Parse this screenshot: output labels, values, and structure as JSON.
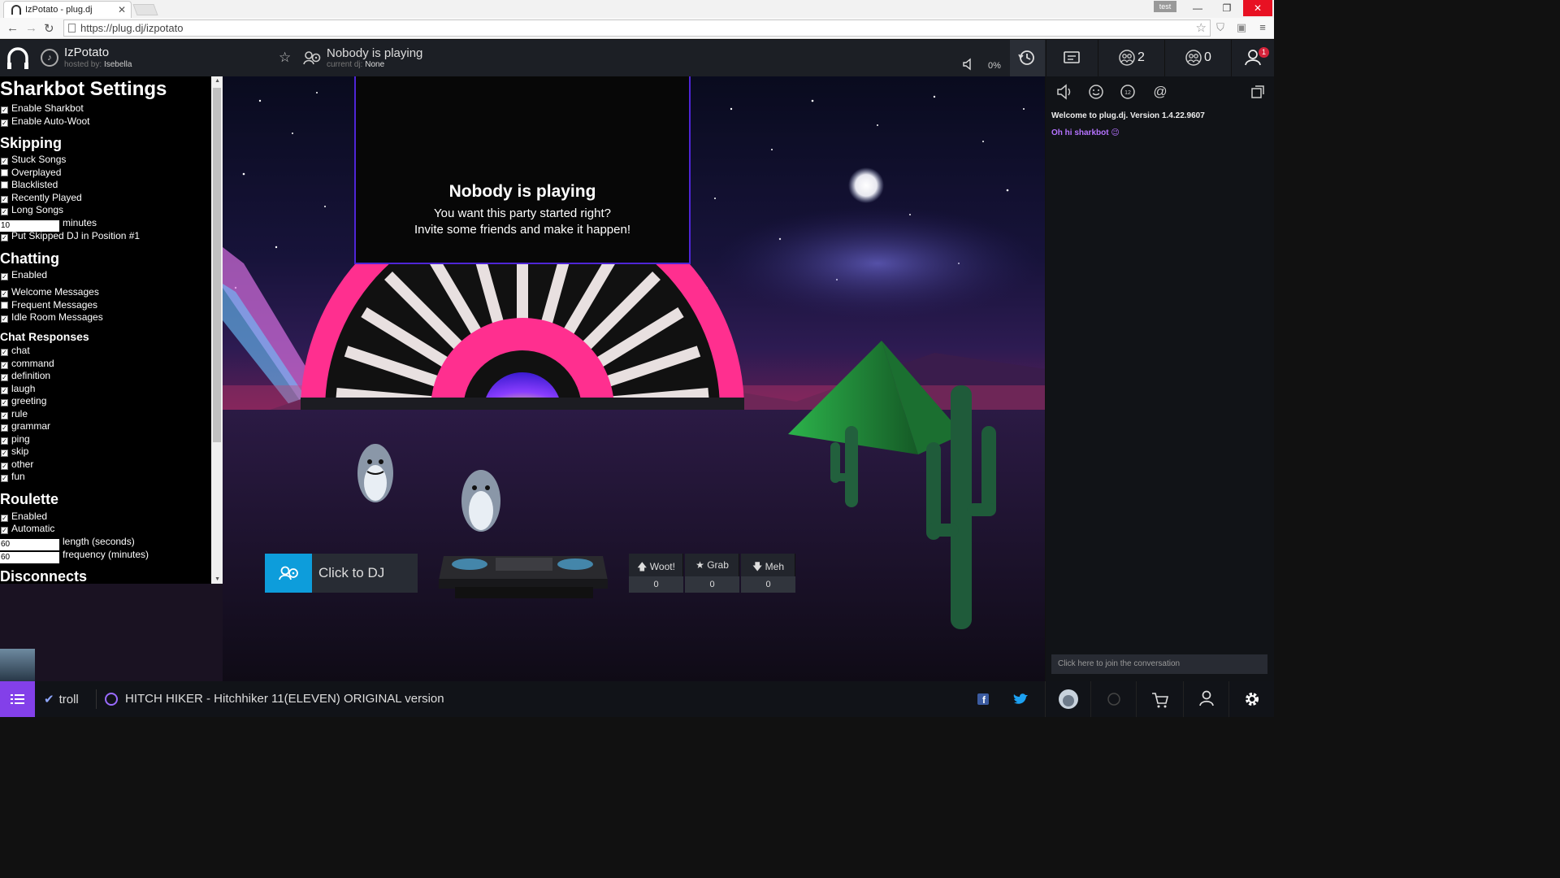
{
  "browser": {
    "tab_title": "IzPotato - plug.dj",
    "url": "https://plug.dj/izpotato",
    "user_badge": "test"
  },
  "header": {
    "room_name": "IzPotato",
    "hosted_by_label": "hosted by:",
    "hosted_by": "Isebella",
    "now_playing": "Nobody is playing",
    "current_dj_label": "current dj:",
    "current_dj": "None",
    "volume": "0%",
    "audience_count": "2",
    "staff_count": "0",
    "notification_count": "1"
  },
  "settings": {
    "title": "Sharkbot Settings",
    "general": [
      {
        "label": "Enable Sharkbot",
        "checked": true
      },
      {
        "label": "Enable Auto-Woot",
        "checked": true
      }
    ],
    "skipping_title": "Skipping",
    "skipping": [
      {
        "label": "Stuck Songs",
        "checked": true
      },
      {
        "label": "Overplayed",
        "checked": false
      },
      {
        "label": "Blacklisted",
        "checked": false
      },
      {
        "label": "Recently Played",
        "checked": true
      },
      {
        "label": "Long Songs",
        "checked": true
      }
    ],
    "long_songs_minutes_value": "10",
    "long_songs_minutes_label": "minutes",
    "put_skipped": {
      "label": "Put Skipped DJ in Position #1",
      "checked": true
    },
    "chatting_title": "Chatting",
    "chatting_enabled": {
      "label": "Enabled",
      "checked": true
    },
    "chatting": [
      {
        "label": "Welcome Messages",
        "checked": true
      },
      {
        "label": "Frequent Messages",
        "checked": false
      },
      {
        "label": "Idle Room Messages",
        "checked": true
      }
    ],
    "chat_responses_title": "Chat Responses",
    "chat_responses": [
      {
        "label": "chat",
        "checked": true
      },
      {
        "label": "command",
        "checked": true
      },
      {
        "label": "definition",
        "checked": true
      },
      {
        "label": "laugh",
        "checked": true
      },
      {
        "label": "greeting",
        "checked": true
      },
      {
        "label": "rule",
        "checked": true
      },
      {
        "label": "grammar",
        "checked": true
      },
      {
        "label": "ping",
        "checked": true
      },
      {
        "label": "skip",
        "checked": true
      },
      {
        "label": "other",
        "checked": true
      },
      {
        "label": "fun",
        "checked": true
      }
    ],
    "roulette_title": "Roulette",
    "roulette": [
      {
        "label": "Enabled",
        "checked": true
      },
      {
        "label": "Automatic",
        "checked": true
      }
    ],
    "roulette_length_value": "60",
    "roulette_length_label": "length (seconds)",
    "roulette_freq_value": "60",
    "roulette_freq_label": "frequency (minutes)",
    "disconnects_title": "Disconnects"
  },
  "video": {
    "title": "Nobody is playing",
    "line1": "You want this party started right?",
    "line2": "Invite some friends and make it happen!"
  },
  "dj": {
    "join_label": "Click to DJ",
    "woot_label": "Woot!",
    "woot_count": "0",
    "grab_label": "Grab",
    "grab_count": "0",
    "meh_label": "Meh",
    "meh_count": "0"
  },
  "chat": {
    "welcome": "Welcome to plug.dj. Version 1.4.22.9607",
    "message": "Oh hi sharkbot 😉",
    "input_placeholder": "Click here to join the conversation"
  },
  "footer": {
    "playlist_name": "troll",
    "next_song": "HITCH HIKER - Hitchhiker 11(ELEVEN) ORIGINAL version"
  },
  "colors": {
    "accent_blue": "#0d9ddb",
    "accent_purple": "#8340e9",
    "video_border": "#4e25d6",
    "notification_red": "#d4233a"
  }
}
